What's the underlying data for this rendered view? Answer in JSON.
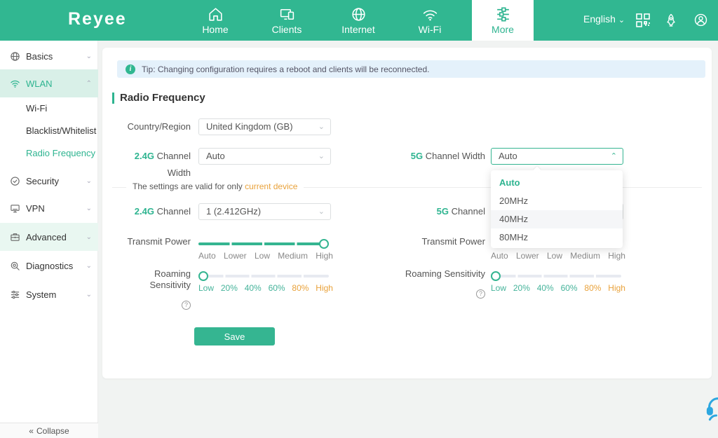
{
  "colors": {
    "accent_green": "#31b791",
    "accent_text_green": "#2eb490",
    "highlight_orange": "#e9a23b",
    "tip_banner_blue": "#e4f1fb",
    "sidebar_active_mint": "#d9f0e8",
    "content_bg_gray": "#f1f3f2",
    "support_icon_blue": "#2da7e0"
  },
  "glyphs": {
    "chevron_down": "⌄",
    "chevron_up": "⌃",
    "collapse": "«",
    "help": "?",
    "info": "i"
  },
  "header": {
    "logo": "Reyee",
    "nav": [
      {
        "label": "Home"
      },
      {
        "label": "Clients"
      },
      {
        "label": "Internet"
      },
      {
        "label": "Wi-Fi"
      },
      {
        "label": "More"
      }
    ],
    "active_tab": "More",
    "language": "English"
  },
  "sidebar": {
    "items": [
      {
        "label": "Basics"
      },
      {
        "label": "WLAN"
      },
      {
        "label": "Wi-Fi"
      },
      {
        "label": "Blacklist/Whitelist"
      },
      {
        "label": "Radio Frequency"
      },
      {
        "label": "Security"
      },
      {
        "label": "VPN"
      },
      {
        "label": "Advanced"
      },
      {
        "label": "Diagnostics"
      },
      {
        "label": "System"
      }
    ],
    "active_group": "WLAN",
    "selected_page": "Radio Frequency",
    "collapse_label": "Collapse"
  },
  "main": {
    "tip": "Tip: Changing configuration requires a reboot and clients will be reconnected.",
    "title": "Radio Frequency",
    "country": {
      "label": "Country/Region",
      "value": "United Kingdom (GB)"
    },
    "width24": {
      "prefix": "2.4G",
      "label": " Channel Width",
      "value": "Auto"
    },
    "width5": {
      "prefix": "5G",
      "label": " Channel Width",
      "value": "Auto"
    },
    "divider": {
      "text": "The settings are valid for only ",
      "highlight": "current device"
    },
    "channel24": {
      "prefix": "2.4G",
      "label": " Channel",
      "value": "1  (2.412GHz)"
    },
    "channel5": {
      "prefix": "5G",
      "label": " Channel"
    },
    "transmit": {
      "label": "Transmit Power",
      "value": "High",
      "ticks": [
        "Auto",
        "Lower",
        "Low",
        "Medium",
        "High"
      ]
    },
    "roaming": {
      "label": "Roaming Sensitivity",
      "value": "Low",
      "ticks": [
        "Low",
        "20%",
        "40%",
        "60%",
        "80%",
        "High"
      ]
    },
    "dropdown": {
      "selected": "Auto",
      "hovered": "40MHz",
      "options": [
        "Auto",
        "20MHz",
        "40MHz",
        "80MHz"
      ]
    },
    "save_label": "Save"
  }
}
